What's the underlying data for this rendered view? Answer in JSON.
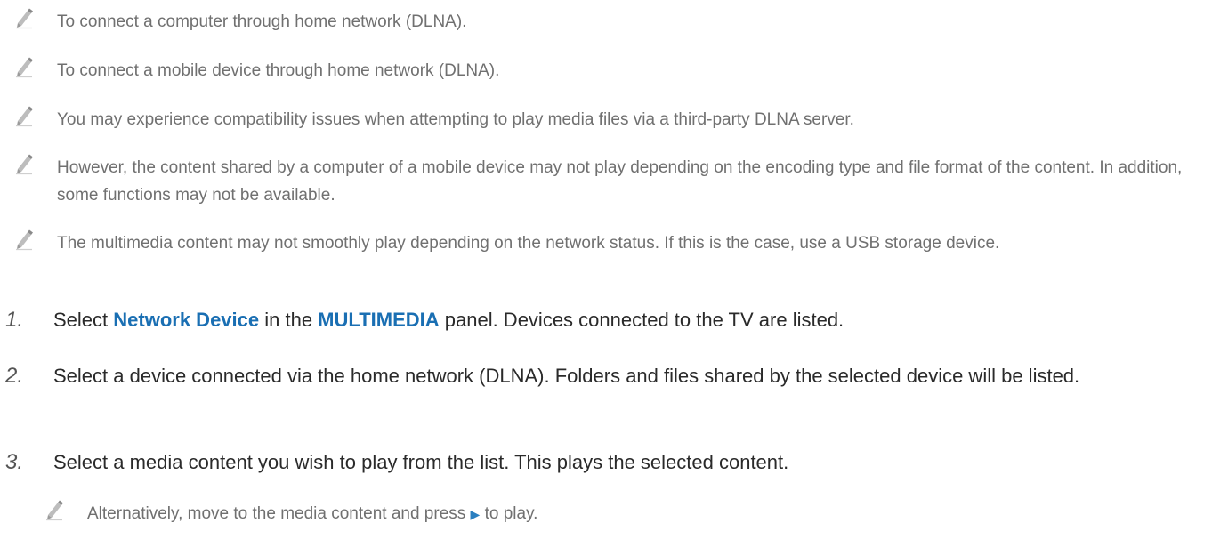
{
  "notes": [
    "To connect a computer through home network (DLNA).",
    "To connect a mobile device through home network (DLNA).",
    "You may experience compatibility issues when attempting to play media files via a third-party DLNA server.",
    "However, the content shared by a computer of a mobile device may not play depending on the encoding type and file format of the content. In addition, some functions may not be available.",
    "The multimedia content may not smoothly play depending on the network status. If this is the case, use a USB storage device."
  ],
  "steps": [
    {
      "number": "1.",
      "text_before": "Select ",
      "highlight_1": "Network Device",
      "text_middle": " in the ",
      "highlight_2": "MULTIMEDIA",
      "text_after": " panel. Devices connected to the TV are listed."
    },
    {
      "number": "2.",
      "text": "Select a device connected via the home network (DLNA). Folders and files shared by the selected device will be listed."
    },
    {
      "number": "3.",
      "text": "Select a media content you wish to play from the list. This plays the selected content."
    }
  ],
  "sub_note": {
    "text_before": "Alternatively, move to the media content and press ",
    "glyph": "▶",
    "text_after": " to play."
  },
  "icons": {
    "note_icon": "pencil-icon",
    "play_icon": "play-icon"
  },
  "colors": {
    "note_text": "#707070",
    "step_text": "#2a2a2a",
    "highlight": "#1a6fb3"
  }
}
